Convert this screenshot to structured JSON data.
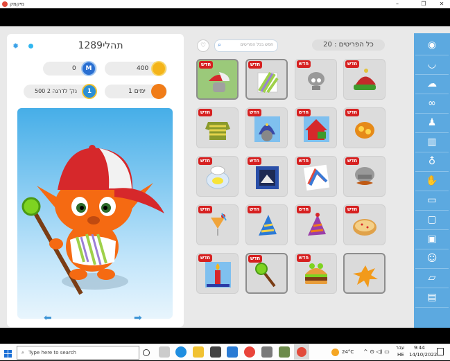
{
  "window": {
    "title": "מיקמק",
    "controls": [
      "–",
      "❐",
      "✕"
    ]
  },
  "player": {
    "name": "תהלי1289",
    "coins": "400",
    "m_points": "0",
    "days": "1 ימים",
    "level_points": "500 נק' לדרגה 2"
  },
  "toolbar": {
    "total_label": "כל הפריטים : 20",
    "search_placeholder": "חפש בכל הפריטים"
  },
  "items": [
    {
      "name": "cap-hat",
      "new": "חדש",
      "selected": true
    },
    {
      "name": "striped-shirt",
      "new": "חדש",
      "selected": true
    },
    {
      "name": "gray-helmet",
      "new": "חדש",
      "selected": false
    },
    {
      "name": "elf-hat",
      "new": "חדש",
      "selected": false
    },
    {
      "name": "green-sweater",
      "new": "חדש",
      "selected": false
    },
    {
      "name": "wizard-hat",
      "new": "חדש",
      "selected": false
    },
    {
      "name": "red-house",
      "new": "חדש",
      "selected": false
    },
    {
      "name": "orange-flower",
      "new": "חדש",
      "selected": false
    },
    {
      "name": "egg-nest",
      "new": "חדש",
      "selected": false
    },
    {
      "name": "framed-picture",
      "new": "חדש",
      "selected": false
    },
    {
      "name": "rainbow-picture",
      "new": "חדש",
      "selected": false
    },
    {
      "name": "mustache-helmet",
      "new": "חדש",
      "selected": false
    },
    {
      "name": "cocktail",
      "new": "חדש",
      "selected": false
    },
    {
      "name": "party-hat-blue",
      "new": "חדש",
      "selected": false
    },
    {
      "name": "party-hat-purple",
      "new": "חדש",
      "selected": false
    },
    {
      "name": "donut",
      "new": "חדש",
      "selected": false
    },
    {
      "name": "birthday-candle",
      "new": "חדש",
      "selected": false
    },
    {
      "name": "magic-staff",
      "new": "חדש",
      "selected": true
    },
    {
      "name": "burger",
      "new": "חדש",
      "selected": false
    },
    {
      "name": "paint-splat",
      "new": "",
      "selected": true
    }
  ],
  "categories": [
    "hat-icon",
    "cap-icon",
    "hair-icon",
    "glasses-icon",
    "shirt-icon",
    "coat-icon",
    "necklace-icon",
    "glove-icon",
    "shorts-icon",
    "shoe-icon",
    "bag-icon",
    "robot-icon",
    "eraser-icon",
    "box-icon"
  ],
  "taskbar": {
    "search_placeholder": "Type here to search",
    "temperature": "24°C",
    "language_top": "עבר",
    "language_bottom": "HE",
    "time": "9:44",
    "date": "14/10/2022"
  }
}
